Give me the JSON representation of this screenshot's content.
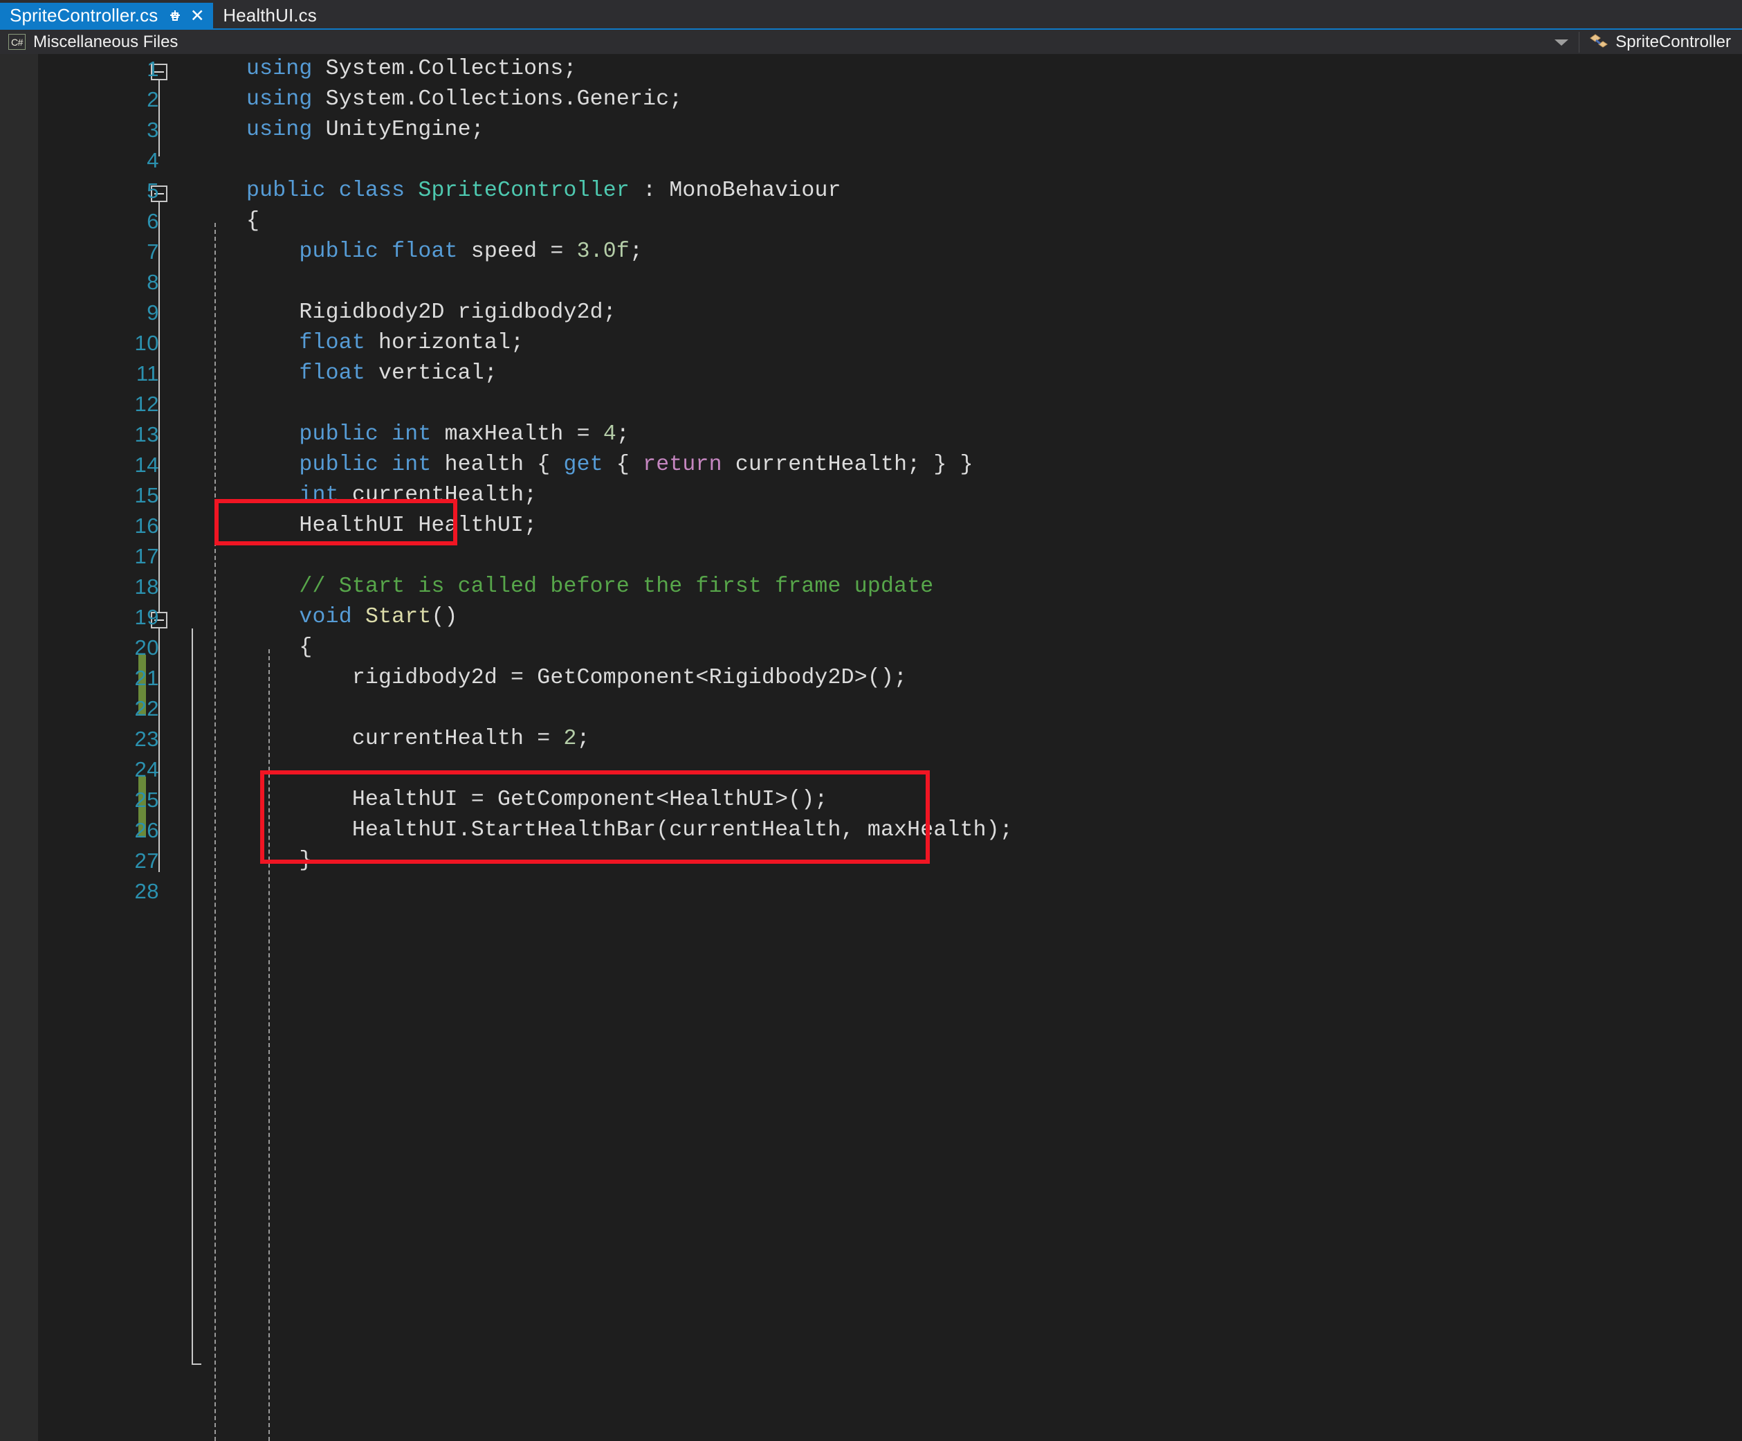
{
  "window": {
    "accent_color": "#0e7ac8",
    "editor_bg": "#1e1e1e",
    "chrome_bg": "#2d2d30"
  },
  "tabs": [
    {
      "label": "SpriteController.cs",
      "active": true,
      "pin_icon": "pin-icon",
      "close_icon": "close-icon"
    },
    {
      "label": "HealthUI.cs",
      "active": false
    }
  ],
  "navbar": {
    "project_badge": "C#",
    "project_label": "Miscellaneous Files",
    "dropdown_icon": "chevron-down-icon",
    "member_icon": "class-icon",
    "member_label": "SpriteController"
  },
  "editor": {
    "first_line": 1,
    "last_line": 28,
    "line_numbers": [
      1,
      2,
      3,
      4,
      5,
      6,
      7,
      8,
      9,
      10,
      11,
      12,
      13,
      14,
      15,
      16,
      17,
      18,
      19,
      20,
      21,
      22,
      23,
      24,
      25,
      26,
      27,
      28
    ],
    "change_bars": [
      {
        "from_line": 21,
        "to_line": 22
      },
      {
        "from_line": 25,
        "to_line": 26
      }
    ],
    "fold_markers": [
      {
        "line": 1,
        "state": "expanded"
      },
      {
        "line": 5,
        "state": "expanded"
      },
      {
        "line": 19,
        "state": "expanded"
      }
    ],
    "lines": [
      {
        "n": 1,
        "text": "using System.Collections;"
      },
      {
        "n": 2,
        "text": "using System.Collections.Generic;"
      },
      {
        "n": 3,
        "text": "using UnityEngine;"
      },
      {
        "n": 4,
        "text": ""
      },
      {
        "n": 5,
        "text": "public class SpriteController : MonoBehaviour"
      },
      {
        "n": 6,
        "text": "{"
      },
      {
        "n": 7,
        "text": "    public float speed = 3.0f;"
      },
      {
        "n": 8,
        "text": ""
      },
      {
        "n": 9,
        "text": "    Rigidbody2D rigidbody2d;"
      },
      {
        "n": 10,
        "text": "    float horizontal;"
      },
      {
        "n": 11,
        "text": "    float vertical;"
      },
      {
        "n": 12,
        "text": ""
      },
      {
        "n": 13,
        "text": "    public int maxHealth = 4;"
      },
      {
        "n": 14,
        "text": "    public int health { get { return currentHealth; } }"
      },
      {
        "n": 15,
        "text": "    int currentHealth;"
      },
      {
        "n": 16,
        "text": "    HealthUI HealthUI;"
      },
      {
        "n": 17,
        "text": ""
      },
      {
        "n": 18,
        "text": "    // Start is called before the first frame update"
      },
      {
        "n": 19,
        "text": "    void Start()"
      },
      {
        "n": 20,
        "text": "    {"
      },
      {
        "n": 21,
        "text": "        rigidbody2d = GetComponent<Rigidbody2D>();"
      },
      {
        "n": 22,
        "text": ""
      },
      {
        "n": 23,
        "text": "        currentHealth = 2;"
      },
      {
        "n": 24,
        "text": ""
      },
      {
        "n": 25,
        "text": "        HealthUI = GetComponent<HealthUI>();"
      },
      {
        "n": 26,
        "text": "        HealthUI.StartHealthBar(currentHealth, maxHealth);"
      },
      {
        "n": 27,
        "text": "    }"
      },
      {
        "n": 28,
        "text": ""
      }
    ]
  },
  "annotations": {
    "highlight_color": "#f01523",
    "boxes": [
      {
        "name": "healthui-field-highlight",
        "covers_lines": "16"
      },
      {
        "name": "healthui-start-highlight",
        "covers_lines": "25-26"
      }
    ]
  }
}
